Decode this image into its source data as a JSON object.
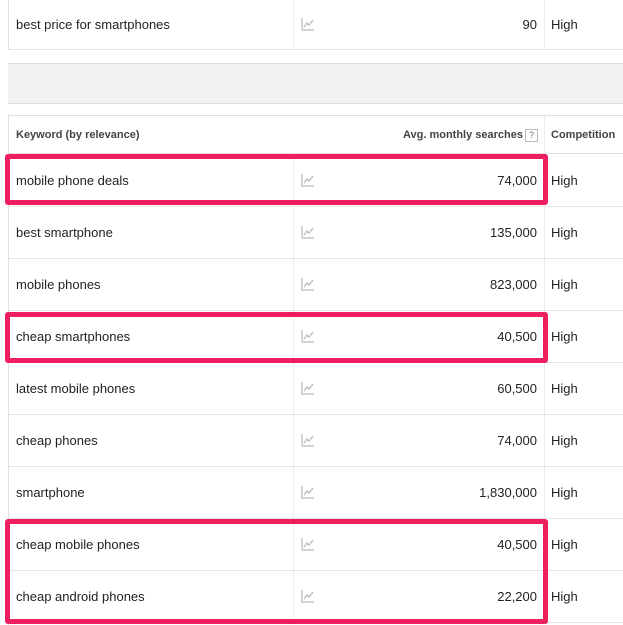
{
  "top_row": {
    "keyword": "best price for smartphones",
    "avg_searches": "90",
    "competition": "High"
  },
  "header": {
    "keyword_col": "Keyword (by relevance)",
    "avg_col": "Avg. monthly searches",
    "help_glyph": "?",
    "competition_col": "Competition"
  },
  "rows": [
    {
      "keyword": "mobile phone deals",
      "avg_searches": "74,000",
      "competition": "High"
    },
    {
      "keyword": "best smartphone",
      "avg_searches": "135,000",
      "competition": "High"
    },
    {
      "keyword": "mobile phones",
      "avg_searches": "823,000",
      "competition": "High"
    },
    {
      "keyword": "cheap smartphones",
      "avg_searches": "40,500",
      "competition": "High"
    },
    {
      "keyword": "latest mobile phones",
      "avg_searches": "60,500",
      "competition": "High"
    },
    {
      "keyword": "cheap phones",
      "avg_searches": "74,000",
      "competition": "High"
    },
    {
      "keyword": "smartphone",
      "avg_searches": "1,830,000",
      "competition": "High"
    },
    {
      "keyword": "cheap mobile phones",
      "avg_searches": "40,500",
      "competition": "High"
    },
    {
      "keyword": "cheap android phones",
      "avg_searches": "22,200",
      "competition": "High"
    }
  ],
  "icons": {
    "trend": "trend-chart-icon"
  },
  "colors": {
    "highlight": "#ee1f5e",
    "text": "#222222",
    "divider": "#e5e5e5"
  }
}
